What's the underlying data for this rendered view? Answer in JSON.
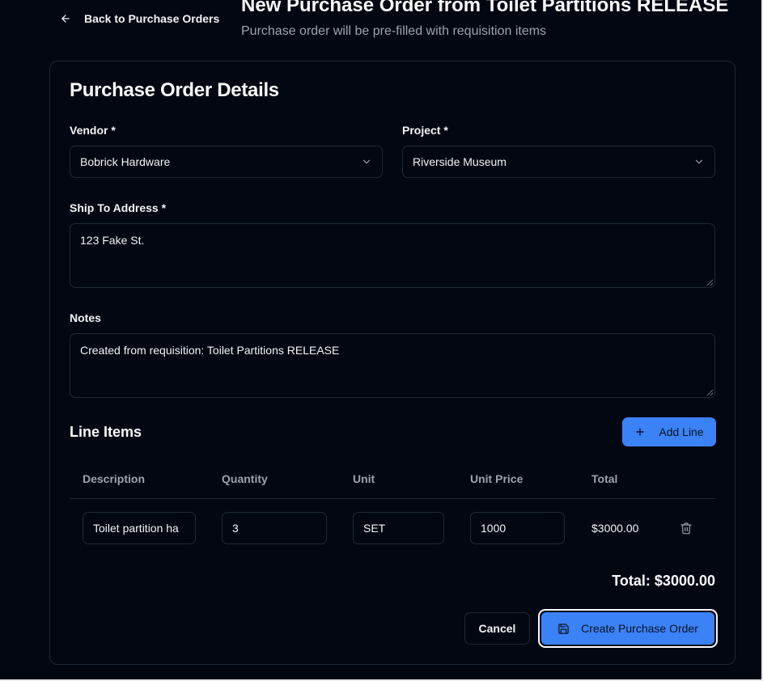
{
  "header": {
    "back_label": "Back to Purchase Orders",
    "title": "New Purchase Order from Toilet Partitions RELEASE",
    "subtitle": "Purchase order will be pre-filled with requisition items"
  },
  "form": {
    "card_title": "Purchase Order Details",
    "vendor_label": "Vendor *",
    "vendor_value": "Bobrick Hardware",
    "project_label": "Project *",
    "project_value": "Riverside Museum",
    "ship_label": "Ship To Address *",
    "ship_value": "123 Fake St.",
    "notes_label": "Notes",
    "notes_value": "Created from requisition: Toilet Partitions RELEASE"
  },
  "line_items": {
    "title": "Line Items",
    "add_label": "Add Line",
    "columns": [
      "Description",
      "Quantity",
      "Unit",
      "Unit Price",
      "Total"
    ],
    "rows": [
      {
        "description": "Toilet partition ha",
        "quantity": "3",
        "unit": "SET",
        "unit_price": "1000",
        "total": "$3000.00"
      }
    ],
    "grand_total": "Total: $3000.00"
  },
  "actions": {
    "cancel_label": "Cancel",
    "create_label": "Create Purchase Order"
  },
  "icons": {
    "back": "arrow-left-icon",
    "dropdown": "chevron-down-icon",
    "add": "plus-icon",
    "delete": "trash-icon",
    "save": "save-icon"
  },
  "colors": {
    "background": "#030712",
    "border": "#1f2937",
    "accent": "#3b82f6",
    "muted_text": "#9ca3af",
    "text": "#f3f4f6"
  }
}
